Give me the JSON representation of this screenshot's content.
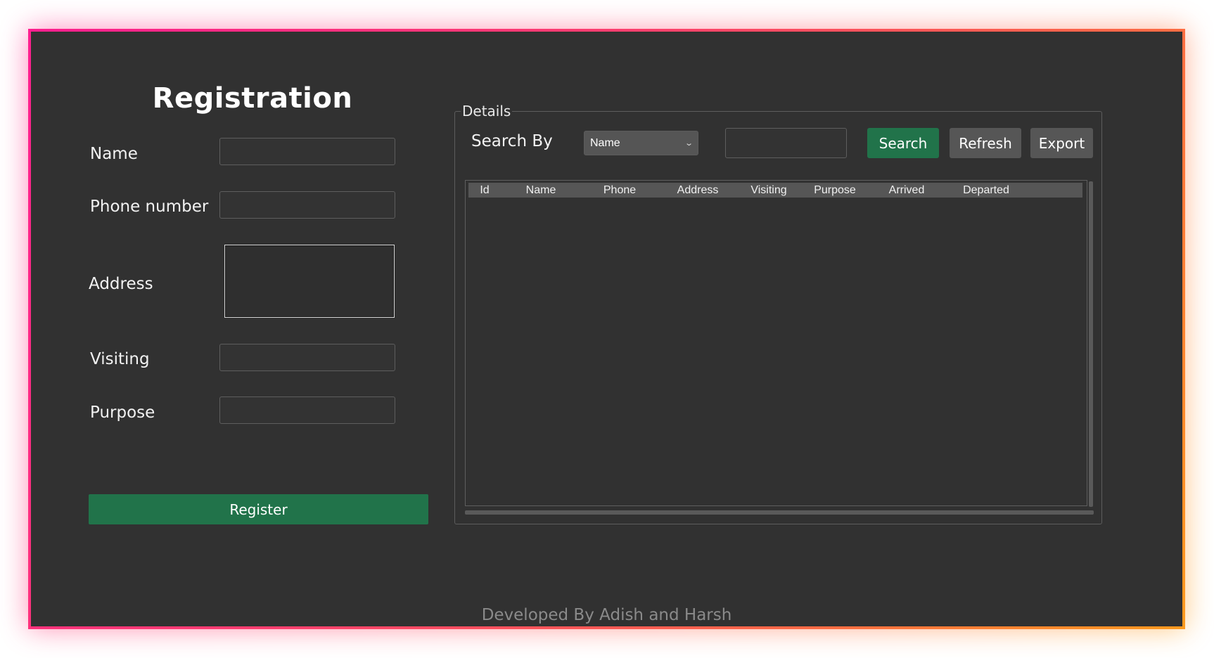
{
  "registration": {
    "title": "Registration",
    "fields": {
      "name_label": "Name",
      "phone_label": "Phone number",
      "address_label": "Address",
      "visiting_label": "Visiting",
      "purpose_label": "Purpose"
    },
    "values": {
      "name": "",
      "phone": "",
      "address": "",
      "visiting": "",
      "purpose": ""
    },
    "register_label": "Register"
  },
  "details": {
    "legend": "Details",
    "search_by_label": "Search By",
    "search_by_selected": "Name",
    "search_value": "",
    "search_button": "Search",
    "refresh_button": "Refresh",
    "export_button": "Export",
    "table": {
      "columns": [
        "Id",
        "Name",
        "Phone",
        "Address",
        "Visiting",
        "Purpose",
        "Arrived",
        "Departed"
      ],
      "rows": []
    }
  },
  "footer": {
    "credit": "Developed By Adish and Harsh"
  },
  "colors": {
    "background": "#313131",
    "accent_green": "#21734a",
    "button_gray": "#565656",
    "frame_gradient_start": "#ff1f8f",
    "frame_gradient_end": "#ff9a1e"
  }
}
